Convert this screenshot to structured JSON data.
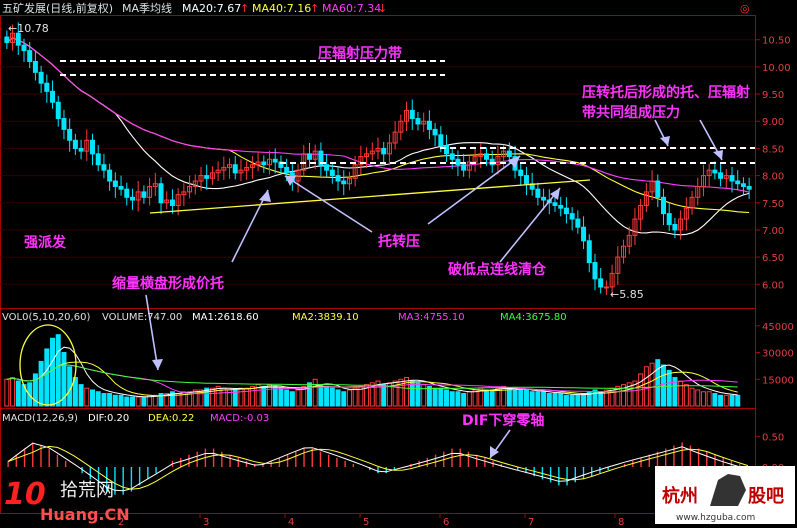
{
  "header": {
    "stock": "五矿发展(日线,前复权)",
    "ma_title": "MA季均线",
    "ma20": "MA20:7.67",
    "ma40": "MA40:7.16",
    "ma60": "MA60:7.34"
  },
  "price_panel": {
    "high_label": "10.78",
    "low_label": "5.85",
    "y_ticks": [
      "10.50",
      "10.00",
      "9.50",
      "9.00",
      "8.50",
      "8.00",
      "7.50",
      "7.00",
      "6.50",
      "6.00"
    ]
  },
  "volume_panel": {
    "title": "VOL0(5,10,20,60)",
    "volume": "VOLUME:747.00",
    "ma1": "MA1:2618.60",
    "ma2": "MA2:3839.10",
    "ma3": "MA3:4755.10",
    "ma4": "MA4:3675.80",
    "y_ticks": [
      "45000",
      "30000",
      "15000"
    ]
  },
  "macd_panel": {
    "title": "MACD(12,26,9)",
    "dif": "DIF:0.20",
    "dea": "DEA:0.22",
    "macd": "MACD:-0.03",
    "y_ticks": [
      "0.50",
      "0.00"
    ]
  },
  "x_axis": {
    "labels": [
      "2",
      "3",
      "4",
      "5",
      "6",
      "7",
      "8"
    ]
  },
  "annotations": {
    "pressure_band": "压辐射压力带",
    "top_right_1": "压转托后形成的托、压辐射",
    "top_right_2": "带共同组成压力",
    "strong_rise": "强派发",
    "shrink": "缩量横盘形成价托",
    "support_to_pressure": "托转压",
    "break_low": "破低点连线清仓",
    "dif_cross": "DIF下穿零轴"
  },
  "watermarks": {
    "left_cn": "拾荒网",
    "left_num": "10",
    "left_url": "Huang.CN",
    "right_cn_1": "杭州",
    "right_cn_2": "股吧",
    "right_url": "www.hzguba.com"
  },
  "colors": {
    "up": "#ff3b3b",
    "down": "#00e5ff",
    "ma20": "#ffffff",
    "ma40": "#ffff3c",
    "ma60": "#ff3cff",
    "axis": "#aa0000",
    "annotation": "#ff33ff"
  },
  "chart_data": {
    "type": "candlestick",
    "ylim": [
      5.6,
      10.9
    ],
    "ma_periods": [
      20,
      40,
      60
    ],
    "closes": [
      10.45,
      10.62,
      10.4,
      10.3,
      10.1,
      9.9,
      9.7,
      9.55,
      9.35,
      9.05,
      8.85,
      8.65,
      8.5,
      8.45,
      8.65,
      8.4,
      8.2,
      8.1,
      7.9,
      7.8,
      7.75,
      7.6,
      7.55,
      7.7,
      7.6,
      7.8,
      7.85,
      7.5,
      7.55,
      7.45,
      7.65,
      7.7,
      7.8,
      7.9,
      8.0,
      7.95,
      8.05,
      8.1,
      8.15,
      8.2,
      8.05,
      8.1,
      8.15,
      8.2,
      8.25,
      8.2,
      8.3,
      8.25,
      8.15,
      8.05,
      7.9,
      8.1,
      8.4,
      8.3,
      8.45,
      8.2,
      8.1,
      8.0,
      7.9,
      7.85,
      7.95,
      8.2,
      8.35,
      8.4,
      8.45,
      8.5,
      8.4,
      8.6,
      8.8,
      9.0,
      9.2,
      9.05,
      8.95,
      9.0,
      8.85,
      8.75,
      8.55,
      8.4,
      8.3,
      8.2,
      8.1,
      8.25,
      8.35,
      8.4,
      8.3,
      8.2,
      8.35,
      8.45,
      8.35,
      8.1,
      8.0,
      7.85,
      7.75,
      7.6,
      7.55,
      7.5,
      7.45,
      7.4,
      7.3,
      7.2,
      7.05,
      6.8,
      6.4,
      6.1,
      5.95,
      5.95,
      6.2,
      6.5,
      6.7,
      6.9,
      7.2,
      7.45,
      7.7,
      7.9,
      7.6,
      7.3,
      7.1,
      7.0,
      7.2,
      7.4,
      7.6,
      7.8,
      8.0,
      8.1,
      8.05,
      7.95,
      8.0,
      7.9,
      7.85,
      7.8,
      7.75
    ],
    "volume_max": 46000,
    "volumes": [
      15,
      16,
      14,
      12,
      13,
      18,
      25,
      32,
      38,
      40,
      30,
      22,
      16,
      12,
      10,
      9,
      8,
      7,
      7,
      6,
      6,
      5,
      5,
      5,
      5,
      6,
      6,
      7,
      7,
      8,
      7,
      8,
      8,
      9,
      9,
      10,
      10,
      11,
      10,
      9,
      9,
      10,
      10,
      11,
      12,
      11,
      12,
      11,
      10,
      9,
      8,
      9,
      11,
      13,
      15,
      12,
      11,
      10,
      9,
      8,
      9,
      10,
      11,
      12,
      13,
      14,
      12,
      13,
      14,
      15,
      16,
      14,
      13,
      12,
      11,
      10,
      10,
      9,
      8,
      8,
      7,
      8,
      9,
      10,
      9,
      9,
      10,
      11,
      10,
      9,
      9,
      9,
      8,
      8,
      8,
      7,
      7,
      7,
      6,
      6,
      6,
      7,
      8,
      9,
      8,
      9,
      10,
      11,
      12,
      13,
      14,
      18,
      22,
      24,
      26,
      23,
      20,
      16,
      14,
      12,
      10,
      9,
      8,
      8,
      7,
      6,
      6,
      6,
      6
    ],
    "macd": [
      0.1,
      0.2,
      0.3,
      0.4,
      0.35,
      0.3,
      0.2,
      0.1,
      0.0,
      -0.1,
      -0.2,
      -0.3,
      -0.4,
      -0.45,
      -0.45,
      -0.4,
      -0.3,
      -0.2,
      -0.1,
      0.0,
      0.1,
      0.15,
      0.2,
      0.25,
      0.3,
      0.3,
      0.25,
      0.2,
      0.15,
      0.1,
      0.05,
      0.05,
      0.1,
      0.15,
      0.2,
      0.25,
      0.3,
      0.3,
      0.25,
      0.2,
      0.15,
      0.1,
      0.05,
      0.0,
      -0.05,
      -0.1,
      -0.1,
      -0.05,
      0.0,
      0.05,
      0.1,
      0.15,
      0.2,
      0.25,
      0.3,
      0.3,
      0.25,
      0.2,
      0.15,
      0.1,
      0.05,
      0.0,
      -0.05,
      -0.1,
      -0.15,
      -0.2,
      -0.25,
      -0.3,
      -0.3,
      -0.25,
      -0.2,
      -0.15,
      -0.1,
      -0.05,
      0.0,
      0.05,
      0.1,
      0.15,
      0.2,
      0.25,
      0.3,
      0.35,
      0.4,
      0.35,
      0.3,
      0.25,
      0.2,
      0.15,
      0.1,
      0.05,
      0.0
    ]
  }
}
